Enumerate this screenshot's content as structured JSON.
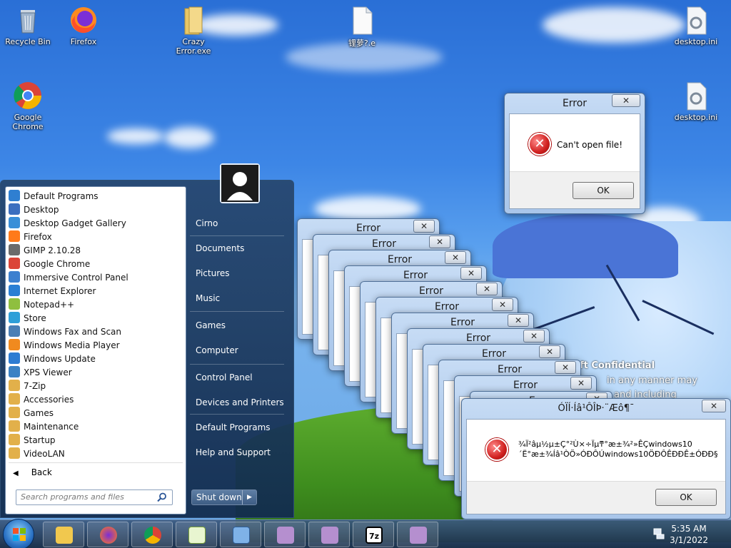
{
  "desktop_icons": [
    {
      "label": "Recycle Bin"
    },
    {
      "label": "Firefox"
    },
    {
      "label": "Crazy Error.exe"
    },
    {
      "label": "锂萝?.e"
    },
    {
      "label": "desktop.ini"
    },
    {
      "label": "Google Chrome"
    },
    {
      "label": "desktop.ini"
    }
  ],
  "overlay_text": {
    "line1": "ft Confidential",
    "line2": "in any manner may",
    "line3": "and including"
  },
  "small_error": {
    "title": "Error",
    "message": "Can't open file!",
    "ok": "OK",
    "close": "✕"
  },
  "stacked_errors": {
    "title": "Error",
    "close": "✕"
  },
  "big_error": {
    "title": "ÓÏÍ·Íâ¹ÔÎÞ·¨Æô¶¯",
    "line1": "¾Ï²âµ½µ±Ç°²Ù×÷Ïµͳ°æ±¾²»ÊÇwindows10",
    "line2": "´Ë°æ±¾Íâ¹ÒÖ»ÓÐÔÚwindows10ÖÐÔÊÐÐÊ±ÓÐÐ§",
    "ok": "OK",
    "close": "✕"
  },
  "start_menu": {
    "programs": [
      "Default Programs",
      "Desktop",
      "Desktop Gadget Gallery",
      "Firefox",
      "GIMP 2.10.28",
      "Google Chrome",
      "Immersive Control Panel",
      "Internet Explorer",
      "Notepad++",
      "Store",
      "Windows Fax and Scan",
      "Windows Media Player",
      "Windows Update",
      "XPS Viewer",
      "7-Zip",
      "Accessories",
      "Games",
      "Maintenance",
      "Startup",
      "VideoLAN"
    ],
    "back": "Back",
    "search_placeholder": "Search programs and files",
    "right_items": [
      "Cirno",
      "Documents",
      "Pictures",
      "Music",
      "Games",
      "Computer",
      "Control Panel",
      "Devices and Printers",
      "Default Programs",
      "Help and Support"
    ],
    "shutdown": "Shut down"
  },
  "taskbar": {
    "items": [
      "explorer",
      "firefox",
      "chrome",
      "notepad++",
      "control-panel",
      "cirno-app-1",
      "cirno-app-2",
      "7z",
      "cirno-app-3"
    ],
    "seven_zip_label": "7z",
    "time": "5:35 AM",
    "date": "3/1/2022"
  },
  "colors": {
    "accent": "#2b72c4",
    "error_red": "#d0201f"
  }
}
